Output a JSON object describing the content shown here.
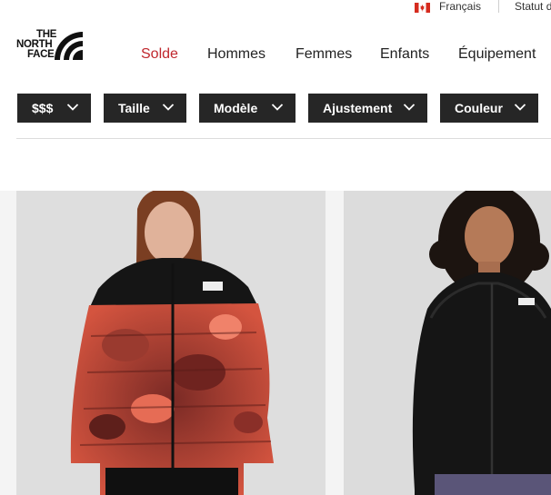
{
  "utility": {
    "language": "Français",
    "status": "Statut d"
  },
  "logo": {
    "line1": "THE",
    "line2": "NORTH",
    "line3": "FACE"
  },
  "nav": {
    "items": [
      {
        "label": "Solde"
      },
      {
        "label": "Hommes"
      },
      {
        "label": "Femmes"
      },
      {
        "label": "Enfants"
      },
      {
        "label": "Équipement"
      }
    ]
  },
  "filters": [
    {
      "label": "$$$"
    },
    {
      "label": "Taille"
    },
    {
      "label": "Modèle"
    },
    {
      "label": "Ajustement"
    },
    {
      "label": "Couleur"
    }
  ],
  "colors": {
    "sale": "#c0272d",
    "filter_bg": "#262626",
    "jacket_red": "#d4543f",
    "jacket_black": "#151515"
  },
  "icons": {
    "flag": "canada-flag-icon",
    "chevron": "chevron-down-icon",
    "logo": "north-face-logo-icon"
  }
}
